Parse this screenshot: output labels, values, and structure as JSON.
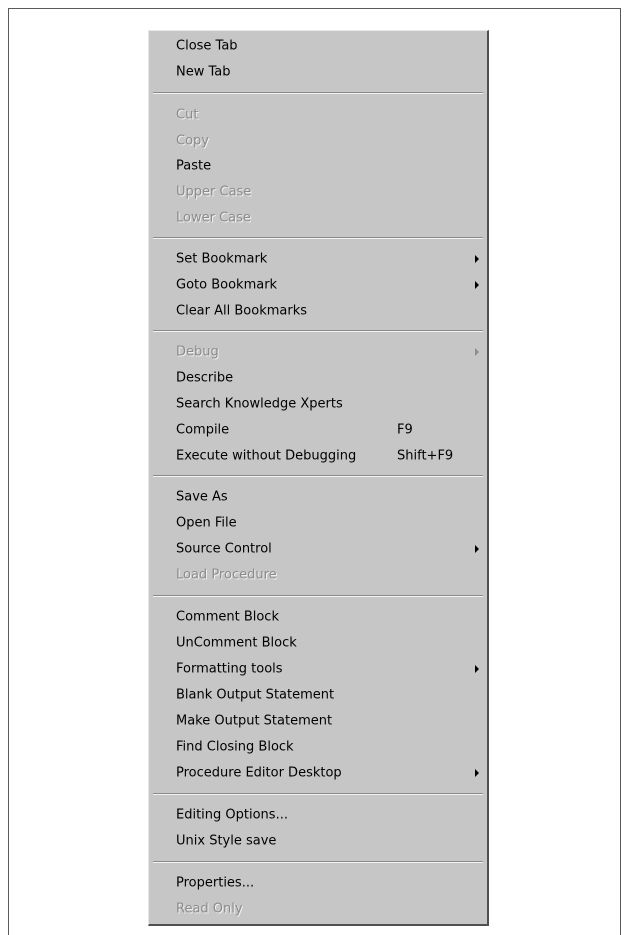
{
  "menu": {
    "close_tab": "Close Tab",
    "new_tab": "New Tab",
    "cut": "Cut",
    "copy": "Copy",
    "paste": "Paste",
    "upper_case": "Upper Case",
    "lower_case": "Lower Case",
    "set_bookmark": "Set Bookmark",
    "goto_bookmark": "Goto Bookmark",
    "clear_all_bookmarks": "Clear All Bookmarks",
    "debug": "Debug",
    "describe": "Describe",
    "search_knowledge_xperts": "Search Knowledge Xperts",
    "compile": "Compile",
    "compile_shortcut": "F9",
    "execute_without_debugging": "Execute without Debugging",
    "execute_shortcut": "Shift+F9",
    "save_as": "Save As",
    "open_file": "Open File",
    "source_control": "Source Control",
    "load_procedure": "Load Procedure",
    "comment_block": "Comment Block",
    "uncomment_block": "UnComment Block",
    "formatting_tools": "Formatting tools",
    "blank_output_statement": "Blank Output Statement",
    "make_output_statement": "Make Output Statement",
    "find_closing_block": "Find Closing Block",
    "procedure_editor_desktop": "Procedure Editor Desktop",
    "editing_options": "Editing Options...",
    "unix_style_save": "Unix Style save",
    "properties": "Properties...",
    "read_only": "Read Only"
  }
}
